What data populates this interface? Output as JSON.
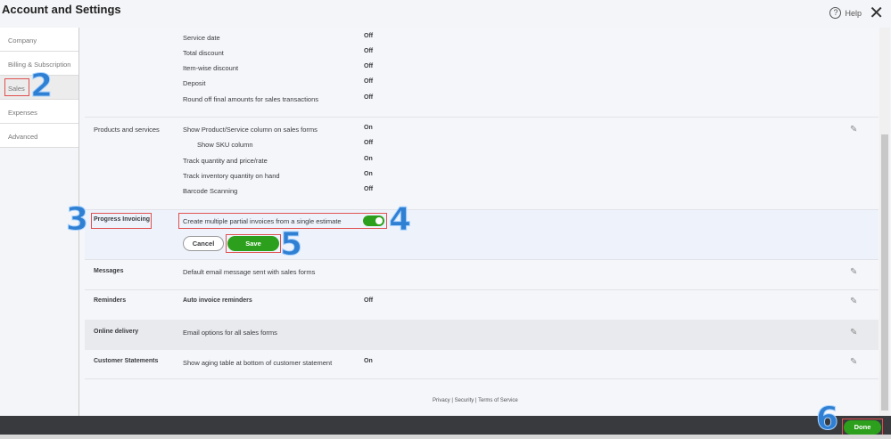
{
  "title": "Account and Settings",
  "help": "Help",
  "sidebar": [
    "Company",
    "Billing & Subscription",
    "Sales",
    "Expenses",
    "Advanced"
  ],
  "sales_form_rows": [
    {
      "desc": "Service date",
      "val": "Off"
    },
    {
      "desc": "Total discount",
      "val": "Off"
    },
    {
      "desc": "Item-wise discount",
      "val": "Off"
    },
    {
      "desc": "Deposit",
      "val": "Off"
    },
    {
      "desc": "Round off final amounts for sales transactions",
      "val": "Off"
    }
  ],
  "products": {
    "label": "Products and services",
    "rows": [
      {
        "desc": "Show Product/Service column on sales forms",
        "val": "On"
      },
      {
        "desc": "Show SKU column",
        "val": "Off"
      },
      {
        "desc": "Track quantity and price/rate",
        "val": "On"
      },
      {
        "desc": "Track inventory quantity on hand",
        "val": "On"
      },
      {
        "desc": "Barcode Scanning",
        "val": "Off"
      }
    ]
  },
  "progress": {
    "label": "Progress Invoicing",
    "desc": "Create multiple partial invoices from a single estimate",
    "enabled": true,
    "cancel": "Cancel",
    "save": "Save"
  },
  "sections": [
    {
      "label": "Messages",
      "desc": "Default email message sent with sales forms",
      "val": ""
    },
    {
      "label": "Reminders",
      "desc": "Auto invoice reminders",
      "val": "Off"
    },
    {
      "label": "Online delivery",
      "desc": "Email options for all sales forms",
      "val": ""
    },
    {
      "label": "Customer Statements",
      "desc": "Show aging table at bottom of customer statement",
      "val": "On"
    }
  ],
  "footer_links": [
    "Privacy",
    "Security",
    "Terms of Service"
  ],
  "done": "Done",
  "annotations": [
    "2",
    "3",
    "4",
    "5",
    "6"
  ],
  "colors": {
    "green": "#2ca01c",
    "annotation": "#2f7fd3",
    "highlight": "#e05050"
  }
}
